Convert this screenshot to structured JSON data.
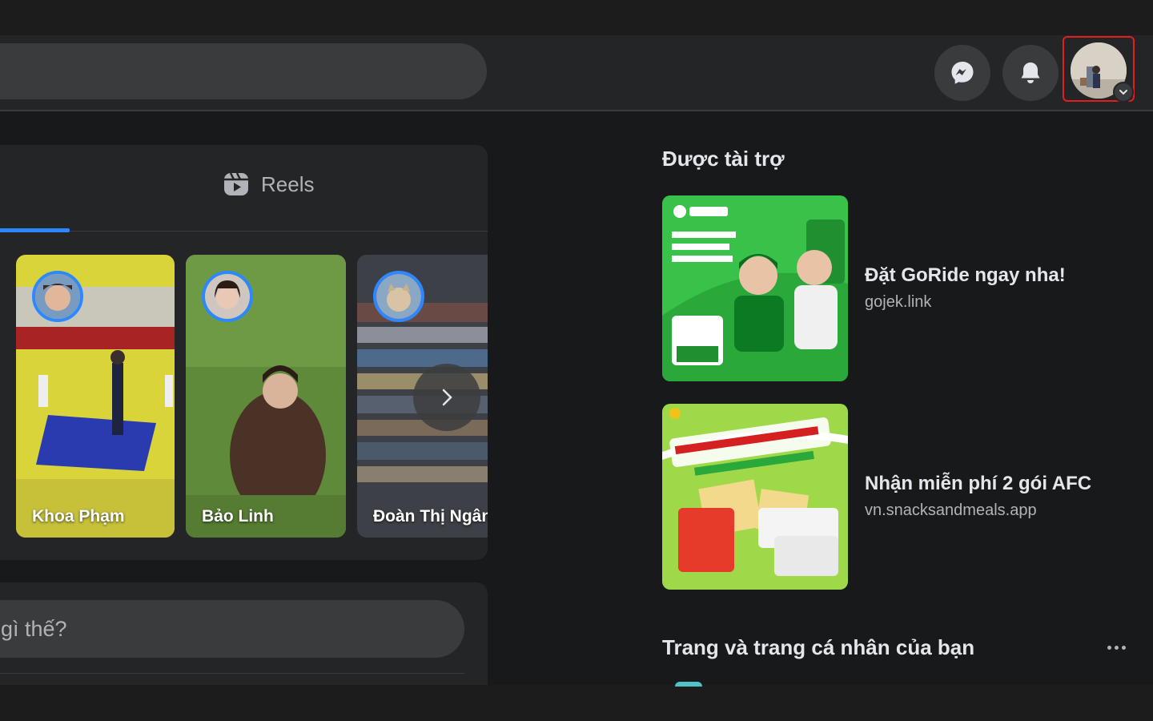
{
  "header": {
    "messenger_icon": "messenger-icon",
    "notifications_icon": "bell-icon"
  },
  "tabs": {
    "reels_label": "Reels"
  },
  "stories": [
    {
      "name": "Khoa Phạm"
    },
    {
      "name": "Bảo Linh"
    },
    {
      "name": "Đoàn Thị Ngân"
    }
  ],
  "composer": {
    "placeholder": "gì thế?"
  },
  "sponsored": {
    "title": "Được tài trợ",
    "ads": [
      {
        "title": "Đặt GoRide ngay nha!",
        "url": "gojek.link"
      },
      {
        "title": "Nhận miễn phí 2 gói AFC",
        "url": "vn.snacksandmeals.app"
      }
    ]
  },
  "pages": {
    "title": "Trang và trang cá nhân của bạn"
  },
  "colors": {
    "accent": "#2d88ff",
    "background": "#18191a",
    "surface": "#242526",
    "highlight_border": "#e41e1e"
  }
}
